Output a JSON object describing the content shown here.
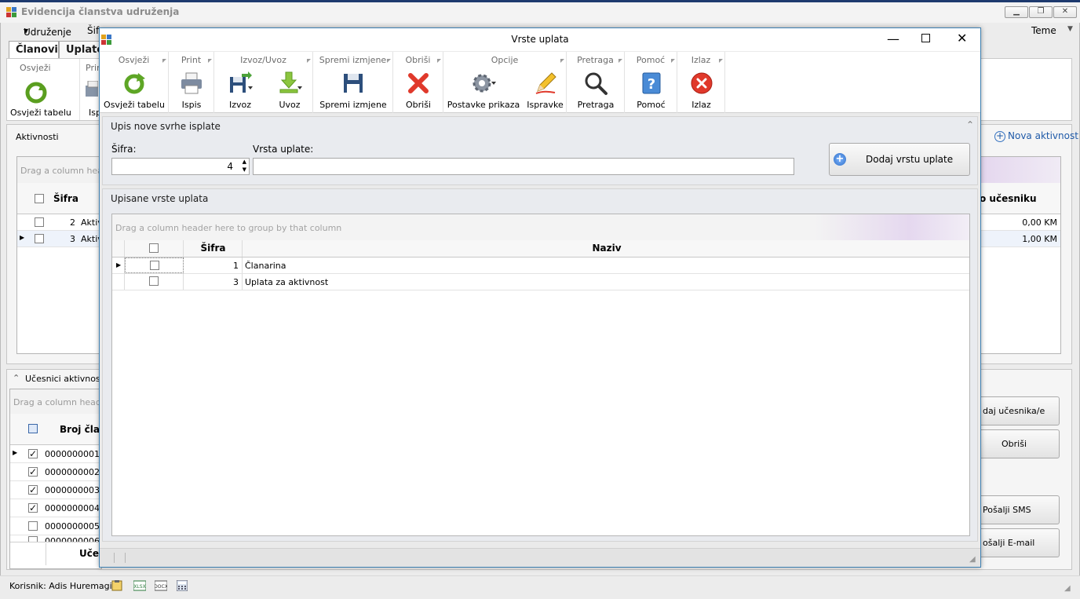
{
  "main": {
    "title": "Evidencija članstva udruženja",
    "menu": {
      "udruzenje": "Udruženje",
      "sifre": "Šifr",
      "teme": "Teme"
    },
    "tabs": [
      "Članovi",
      "Uplate"
    ],
    "ribbon": {
      "osvjezi_group": "Osvježi",
      "osvjezi_label": "Osvježi tabelu",
      "print_group": "Prin",
      "ispis_label": "Isp"
    },
    "aktivnosti": {
      "header": "Aktivnosti",
      "nova_link": "Nova aktivnost",
      "group_hint": "Drag a column heade",
      "col_sifra": "Šifra",
      "col_ucesniku": "o učesniku",
      "rows": [
        {
          "sifra": "2",
          "naziv": "Aktiv",
          "iznos": "0,00 KM"
        },
        {
          "sifra": "3",
          "naziv": "Aktiv",
          "iznos": "1,00 KM"
        }
      ]
    },
    "ucesnici": {
      "header": "Učesnici aktivnosti",
      "group_hint": "Drag a column header",
      "col_broj": "Broj člana",
      "footer_label": "Učes",
      "rows": [
        {
          "broj": "0000000001",
          "checked": true
        },
        {
          "broj": "0000000002",
          "checked": true
        },
        {
          "broj": "0000000003",
          "checked": true
        },
        {
          "broj": "0000000004",
          "checked": true
        },
        {
          "broj": "0000000005",
          "checked": false
        },
        {
          "broj": "0000000006",
          "checked": false
        }
      ],
      "buttons": {
        "dodaj": "daj učesnika/e",
        "obrisi": "Obriši",
        "sms": "Pošalji SMS",
        "email": "ošalji E-mail"
      }
    },
    "status": {
      "korisnik": "Korisnik: Adis Huremagic"
    }
  },
  "dialog": {
    "title": "Vrste uplata",
    "ribbon": {
      "groups": {
        "osvjezi": "Osvježi",
        "print": "Print",
        "izvoz_uvoz": "Izvoz/Uvoz",
        "spremi": "Spremi izmjene",
        "obrisi": "Obriši",
        "opcije": "Opcije",
        "pretraga": "Pretraga",
        "pomoc": "Pomoć",
        "izlaz": "Izlaz"
      },
      "buttons": {
        "osvjezi": "Osvježi tabelu",
        "ispis": "Ispis",
        "izvoz": "Izvoz",
        "uvoz": "Uvoz",
        "spremi": "Spremi izmjene",
        "obrisi": "Obriši",
        "postavke": "Postavke prikaza",
        "ispravke": "Ispravke",
        "pretraga": "Pretraga",
        "pomoc": "Pomoć",
        "izlaz": "Izlaz"
      }
    },
    "upis": {
      "header": "Upis nove svrhe isplate",
      "sifra_label": "Šifra:",
      "sifra_value": "4",
      "vrsta_label": "Vrsta uplate:",
      "vrsta_value": "",
      "dodaj_button": "Dodaj vrstu uplate"
    },
    "upisane": {
      "header": "Upisane vrste uplata",
      "group_hint": "Drag a column header here to group by that column",
      "col_sifra": "Šifra",
      "col_naziv": "Naziv",
      "rows": [
        {
          "sifra": "1",
          "naziv": "Članarina"
        },
        {
          "sifra": "3",
          "naziv": "Uplata za aktivnost"
        }
      ]
    }
  }
}
